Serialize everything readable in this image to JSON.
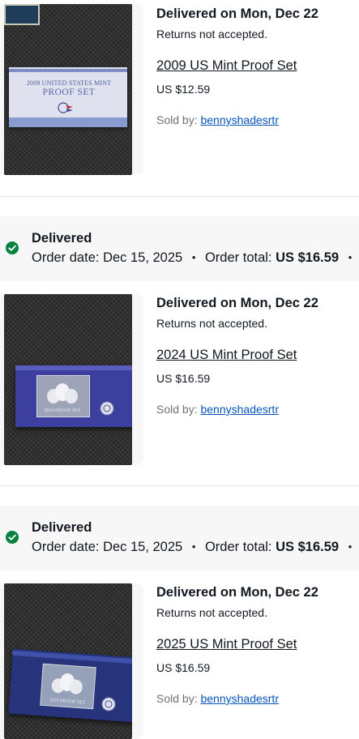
{
  "orders": [
    {
      "item": {
        "delivery": "Delivered on Mon, Dec 22",
        "returns": "Returns not accepted.",
        "title": "2009 US Mint Proof Set",
        "price": "US $12.59",
        "sold_by_label": "Sold by:",
        "seller": "bennyshadesrtr"
      }
    },
    {
      "status": "Delivered",
      "order_date_label": "Order date:",
      "order_date": "Dec 15, 2025",
      "order_total_label": "Order total:",
      "order_total": "US $16.59",
      "item": {
        "delivery": "Delivered on Mon, Dec 22",
        "returns": "Returns not accepted.",
        "title": "2024 US Mint Proof Set",
        "price": "US $16.59",
        "sold_by_label": "Sold by:",
        "seller": "bennyshadesrtr"
      }
    },
    {
      "status": "Delivered",
      "order_date_label": "Order date:",
      "order_date": "Dec 15, 2025",
      "order_total_label": "Order total:",
      "order_total": "US $16.59",
      "item": {
        "delivery": "Delivered on Mon, Dec 22",
        "returns": "Returns not accepted.",
        "title": "2025 US Mint Proof Set",
        "price": "US $16.59",
        "sold_by_label": "Sold by:",
        "seller": "bennyshadesrtr"
      }
    }
  ],
  "thumbnail_text": {
    "box2009_line1": "2009 UNITED STATES MINT",
    "box2009_line2": "PROOF SET",
    "box2024": "2024 PROOF SET",
    "box2025": "2025 PROOF SET"
  },
  "colors": {
    "status_green": "#05823f",
    "link_blue": "#0654ba",
    "header_bg": "#f7f7f7"
  }
}
